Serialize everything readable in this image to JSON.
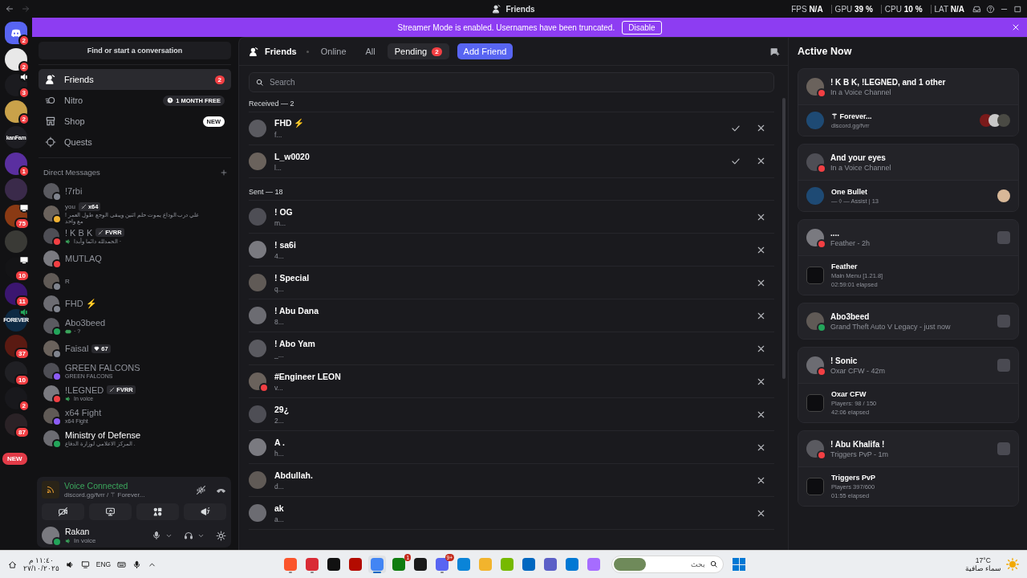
{
  "titlebar": {
    "title": "Friends",
    "stats": [
      {
        "label": "FPS",
        "value": "N/A"
      },
      {
        "label": "GPU",
        "value": "39 %"
      },
      {
        "label": "CPU",
        "value": "10 %"
      },
      {
        "label": "LAT",
        "value": "N/A"
      }
    ]
  },
  "banner": {
    "message": "Streamer Mode is enabled. Usernames have been truncated.",
    "button": "Disable"
  },
  "servers": {
    "items": [
      {
        "kind": "home",
        "color": "#5865f2",
        "badge": "2"
      },
      {
        "kind": "plain",
        "color": "#e8e8e8",
        "badge": "2"
      },
      {
        "kind": "plain",
        "color": "#1b1b1f",
        "badge": "3",
        "indicator": {
          "kind": "speaker",
          "color": "#ffffff"
        }
      },
      {
        "kind": "plain",
        "color": "#c9a24a",
        "badge": "2"
      },
      {
        "kind": "label",
        "color": "#1d1d22",
        "label": "kanFam"
      },
      {
        "kind": "plain",
        "color": "#5a2fa0",
        "badge": "1"
      },
      {
        "kind": "plain",
        "color": "#3a2a4a"
      },
      {
        "kind": "plain",
        "color": "#8a3a14",
        "badge": "75",
        "indicator": {
          "kind": "screen",
          "color": "#ffffff"
        }
      },
      {
        "kind": "plain",
        "color": "#3a3a36"
      },
      {
        "kind": "plain",
        "color": "#141416",
        "badge": "10",
        "indicator": {
          "kind": "screen",
          "color": "#ffffff"
        }
      },
      {
        "kind": "plain",
        "color": "#3b1670",
        "badge": "11"
      },
      {
        "kind": "label",
        "color": "#0e2a44",
        "label": "FOREVER",
        "indicator": {
          "kind": "speaker",
          "color": "#23a55a"
        }
      },
      {
        "kind": "plain",
        "color": "#5a1a12",
        "badge": "37"
      },
      {
        "kind": "plain",
        "color": "#202024",
        "badge": "10"
      },
      {
        "kind": "plain",
        "color": "#18181c",
        "badge": "2"
      },
      {
        "kind": "plain",
        "color": "#2a2226",
        "badge": "87"
      }
    ],
    "new_label": "NEW"
  },
  "sidebar": {
    "search_button": "Find or start a conversation",
    "nav": [
      {
        "kind": "friends",
        "label": "Friends",
        "selected": true,
        "badge": "2"
      },
      {
        "kind": "nitro",
        "label": "Nitro",
        "selected": false,
        "tag": "1 MONTH FREE"
      },
      {
        "kind": "shop",
        "label": "Shop",
        "selected": false,
        "tag": "NEW"
      },
      {
        "kind": "quests",
        "label": "Quests",
        "selected": false
      }
    ],
    "dm_header": "Direct Messages",
    "dms": [
      {
        "name": "!7rbi",
        "color": "#80848e",
        "unread": false
      },
      {
        "name": "you",
        "color": "#f0b232",
        "unread": false,
        "tag": {
          "kind": "guild",
          "text": "x64"
        },
        "subtitle": {
          "kind": "text",
          "text": "! علي درب الوداع يموت حلم اثنين ويبقى الوجع طول العمر مع واحد"
        }
      },
      {
        "name": "! K B K",
        "color": "#f23f43",
        "unread": false,
        "tag": {
          "kind": "guild",
          "text": "FVRR"
        },
        "subtitle": {
          "kind": "voice",
          "text": "الحمدلله دائما وأبدا ·"
        }
      },
      {
        "name": "MUTLAQ",
        "color": "#f23f43",
        "unread": false
      },
      {
        "name": "R",
        "color": "#80848e",
        "unread": false
      },
      {
        "name": "FHD ⚡",
        "color": "#80848e",
        "unread": false
      },
      {
        "name": "Abo3beed",
        "color": "#23a55a",
        "unread": false,
        "subtitle": {
          "kind": "game",
          "text": "· ?"
        }
      },
      {
        "name": "Faisal",
        "color": "#80848e",
        "unread": false,
        "tag": {
          "kind": "gem",
          "text": "67"
        }
      },
      {
        "name": "GREEN FALCONS",
        "color": "#8c5cf5",
        "unread": false,
        "subtitle": {
          "kind": "text",
          "text": "GREEN FALCONS"
        }
      },
      {
        "name": "!LEGNED",
        "color": "#f23f43",
        "unread": false,
        "tag": {
          "kind": "guild",
          "text": "FVRR"
        },
        "subtitle": {
          "kind": "voice",
          "text": "In voice"
        }
      },
      {
        "name": "x64 Fight",
        "color": "#8c5cf5",
        "unread": false,
        "subtitle": {
          "kind": "text",
          "text": "x64 Fight"
        }
      },
      {
        "name": "Ministry of Defense",
        "color": "#23a55a",
        "unread": true,
        "subtitle": {
          "kind": "text",
          "text": "المركز الاعلامي لوزارة الدفاع ."
        }
      }
    ],
    "voice": {
      "status": "Voice Connected",
      "channel": "discord.gg/fvrr / ⚚ Forever..."
    },
    "user": {
      "name": "Rakan",
      "color": "#23a55a",
      "activity": "In voice"
    }
  },
  "main": {
    "title": "Friends",
    "tabs": [
      {
        "label": "Online",
        "selected": false
      },
      {
        "label": "All",
        "selected": false
      },
      {
        "label": "Pending",
        "selected": true,
        "badge": "2"
      }
    ],
    "add_friend": "Add Friend",
    "search": {
      "placeholder": "Search"
    },
    "sections": [
      {
        "title": "Received — 2",
        "requests": [
          {
            "name": "FHD ⚡",
            "subtitle": "f...",
            "kind": "incoming"
          },
          {
            "name": "L_w0020",
            "subtitle": "l...",
            "kind": "incoming"
          }
        ]
      },
      {
        "title": "Sent — 18",
        "requests": [
          {
            "name": "! OG",
            "subtitle": "m...",
            "kind": "outgoing"
          },
          {
            "name": "! sa6i",
            "subtitle": "4...",
            "kind": "outgoing"
          },
          {
            "name": "! Special",
            "subtitle": "q...",
            "kind": "outgoing"
          },
          {
            "name": "! Abu Dana",
            "subtitle": "8...",
            "kind": "outgoing"
          },
          {
            "name": "! Abo Yam",
            "subtitle": "_...",
            "kind": "outgoing"
          },
          {
            "name": "#Engineer LEON",
            "subtitle": "v...",
            "kind": "outgoing",
            "color": "#f23f43"
          },
          {
            "name": "29¿",
            "subtitle": "2...",
            "kind": "outgoing"
          },
          {
            "name": "A .",
            "subtitle": "h...",
            "kind": "outgoing"
          },
          {
            "name": "Abdullah.",
            "subtitle": "d...",
            "kind": "outgoing"
          },
          {
            "name": "ak",
            "subtitle": "a...",
            "kind": "outgoing"
          }
        ]
      }
    ]
  },
  "active_now": {
    "title": "Active Now",
    "cards": [
      {
        "name": "! K B K, !LEGNED, and 1 other",
        "subtitle": "In a Voice Channel",
        "color": "#f23f43",
        "game_icon": false,
        "detail": {
          "kind": "voice",
          "title": "⚚ Forever...",
          "lines": [
            "discord.gg/fvrr"
          ],
          "members": [
            {
              "color": "#7a1a1a"
            },
            {
              "color": "#c8c8c8"
            },
            {
              "color": "#4a4a44"
            }
          ]
        }
      },
      {
        "name": "And your eyes",
        "subtitle": "In a Voice Channel",
        "color": "#f23f43",
        "game_icon": false,
        "detail": {
          "kind": "voice",
          "title": "One Bullet",
          "lines": [
            "— ◊ — Assist | 13"
          ],
          "members": [
            {
              "color": "#d8b898"
            }
          ]
        }
      },
      {
        "name": "....",
        "subtitle": "Feather - 2h",
        "color": "#f23f43",
        "game_icon": true,
        "detail": {
          "kind": "game",
          "title": "Feather",
          "lines": [
            "Main Menu [1.21.8]",
            "02:59:01 elapsed"
          ]
        }
      },
      {
        "name": "Abo3beed",
        "subtitle": "Grand Theft Auto V Legacy - just now",
        "color": "#23a55a",
        "game_icon": true
      },
      {
        "name": "! Sonic",
        "subtitle": "Oxar CFW - 42m",
        "color": "#f23f43",
        "game_icon": true,
        "detail": {
          "kind": "game",
          "title": "Oxar CFW",
          "lines": [
            "Players: 98 / 150",
            "42:06 elapsed"
          ]
        }
      },
      {
        "name": "! Abu Khalifa !",
        "subtitle": "Triggers PvP - 1m",
        "color": "#f23f43",
        "game_icon": true,
        "detail": {
          "kind": "game",
          "title": "Triggers PvP",
          "lines": [
            "Players 397/600",
            "01:55 elapsed"
          ]
        }
      }
    ]
  },
  "taskbar": {
    "clock": {
      "time": "١١:٤٠ م",
      "date": "٢٧/١٠/٢٠٢٥"
    },
    "language": "ENG",
    "apps": [
      {
        "color": "#fb542b",
        "selected": false,
        "running": true
      },
      {
        "color": "#d92b35",
        "selected": false,
        "running": true
      },
      {
        "color": "#111111",
        "selected": false,
        "running": false
      },
      {
        "color": "#b30b00",
        "selected": false,
        "running": false
      },
      {
        "color": "#4285f4",
        "selected": true,
        "running": true
      },
      {
        "color": "#107c10",
        "selected": false,
        "running": false,
        "badge": "1"
      },
      {
        "color": "#1a1a1a",
        "selected": false,
        "running": false
      },
      {
        "color": "#5865f2",
        "selected": false,
        "running": true,
        "badge": "9+"
      },
      {
        "color": "#0a84d8",
        "selected": false,
        "running": false
      },
      {
        "color": "#f2b42d",
        "selected": false,
        "running": false
      },
      {
        "color": "#76b900",
        "selected": false,
        "running": false
      },
      {
        "color": "#0067c0",
        "selected": false,
        "running": false
      },
      {
        "color": "#5b5fc7",
        "selected": false,
        "running": false
      },
      {
        "color": "#0078d4",
        "selected": false,
        "running": false
      },
      {
        "color": "#a66cff",
        "selected": false,
        "running": false
      }
    ],
    "search_placeholder": "بحث",
    "weather": {
      "temp": "17°C",
      "condition": "سماء صافية"
    }
  }
}
